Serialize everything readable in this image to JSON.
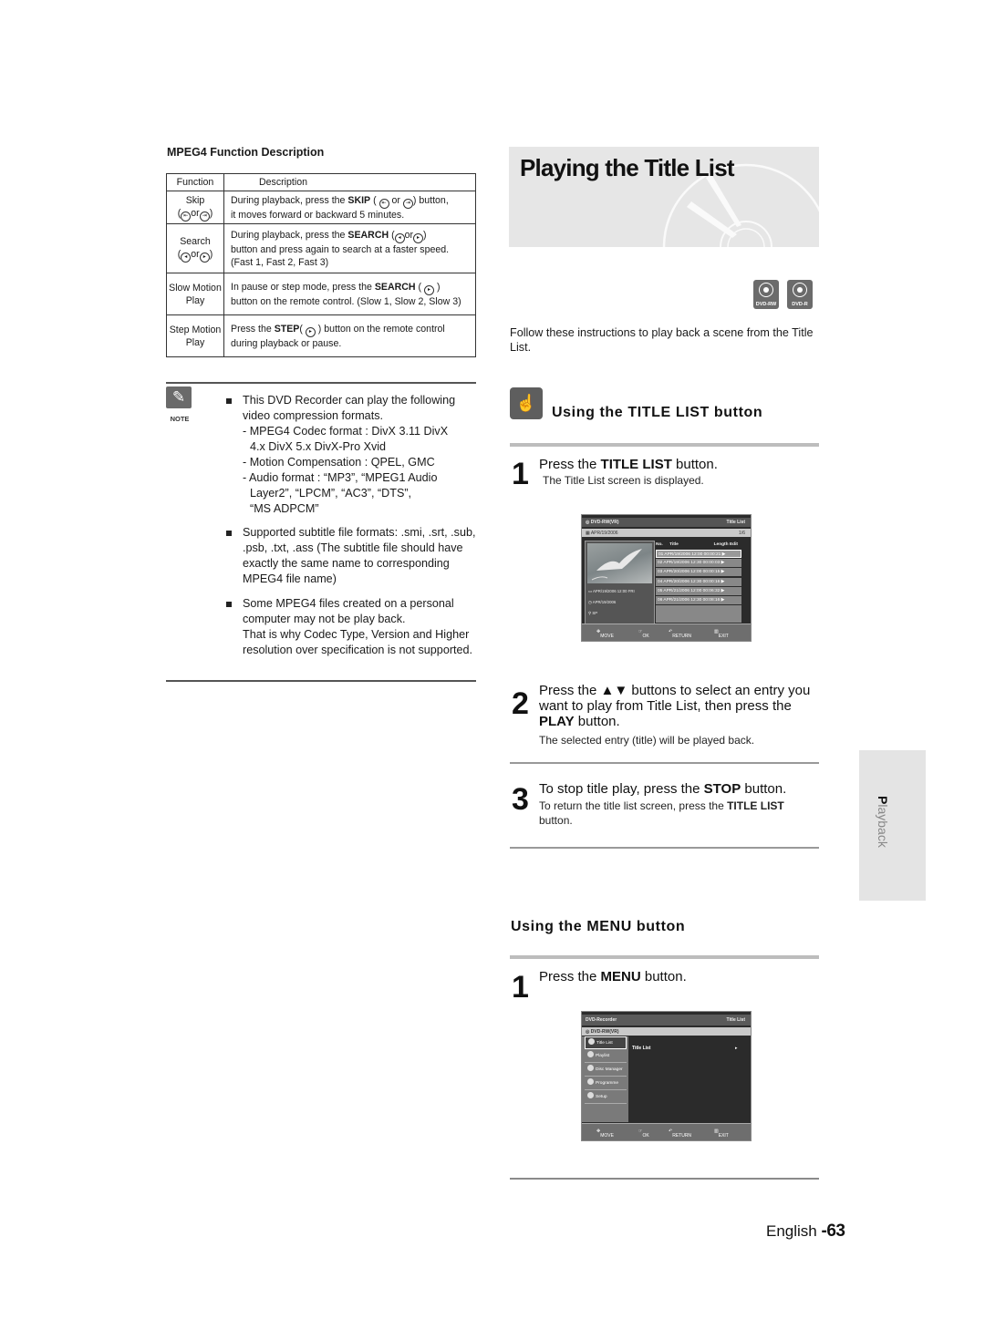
{
  "mpeg4_table": {
    "heading": "MPEG4 Function Description",
    "columns": [
      "Function",
      "Description"
    ],
    "rows": [
      {
        "function": "Skip",
        "function_keys": "or",
        "description_lines": [
          "During playback, press the",
          "SKIP",
          "or",
          "button,",
          "it moves forward or backward 5 minutes."
        ]
      },
      {
        "function": "Search",
        "function_keys": "or",
        "description_lines": [
          "During playback, press the",
          "SEARCH",
          "or",
          "button and press again to search at a faster speed.",
          "(Fast 1, Fast 2, Fast 3)"
        ]
      },
      {
        "function": "Slow Motion",
        "function_line2": "Play",
        "description_lines": [
          "In pause or step mode, press the",
          "SEARCH",
          "button on the remote control. (Slow 1, Slow 2, Slow 3)"
        ]
      },
      {
        "function": "Step Motion",
        "function_line2": "Play",
        "description_lines": [
          "Press the",
          "STEP",
          "button on the remote control",
          "during playback or pause."
        ]
      }
    ]
  },
  "note": {
    "label": "NOTE",
    "icon": "pencil-icon",
    "items": [
      {
        "text": "This DVD Recorder can play the following video compression formats.",
        "subitems": [
          "- MPEG4 Codec format : DivX 3.11 DivX",
          "4.x DivX 5.x DivX-Pro Xvid",
          "- Motion Compensation : QPEL, GMC",
          "- Audio format : “MP3”, “MPEG1 Audio",
          "Layer2”, “LPCM”, “AC3”, “DTS”,",
          "“MS ADPCM”"
        ]
      },
      {
        "text": "Supported subtitle file formats: .smi, .srt, .sub, .psb, .txt, .ass (The subtitle file should have exactly the same name to corresponding MPEG4 file name)"
      },
      {
        "text": "Some MPEG4 files created on a personal computer may not be play back.",
        "text2": "That is why Codec Type, Version and Higher resolution over specification is not supported."
      }
    ]
  },
  "page": {
    "title": "Playing the Title List",
    "disc_badges": [
      "DVD-RW",
      "DVD-R"
    ],
    "intro": "Follow these instructions to play back a scene from the Title List.",
    "side_tab": {
      "first_letter": "P",
      "rest": "layback"
    },
    "footer": {
      "language": "English",
      "page": "-63"
    }
  },
  "title_list_section": {
    "heading": "Using the TITLE LIST button",
    "steps": [
      {
        "number": "1",
        "main_pre": "Press the ",
        "main_bold": "TITLE LIST",
        "main_post": " button.",
        "sub": "The Title List screen is displayed."
      },
      {
        "number": "2",
        "main_pre": "Press the ▲▼ buttons to select an entry you want to play from Title List, then press the ",
        "main_bold": "PLAY",
        "main_post": " button.",
        "sub": "The selected entry (title) will be played back."
      },
      {
        "number": "3",
        "main_pre": "To stop title play, press the ",
        "main_bold": "STOP",
        "main_post": " button.",
        "sub_pre": "To return the title list screen, press the ",
        "sub_bold": "TITLE LIST",
        "sub_post": " button."
      }
    ]
  },
  "title_list_screen": {
    "source": "DVD-RW(VR)",
    "header_right": "Title List",
    "date": "APR/19/2006",
    "counter": "1/6",
    "columns": [
      "No.",
      "Title",
      "Length",
      "Edit"
    ],
    "rows": [
      {
        "no": "01",
        "title": "APR/19/2006 12:00",
        "length": "00:00:21",
        "selected": true
      },
      {
        "no": "02",
        "title": "APR/19/2006 12:30",
        "length": "00:00:03",
        "selected": false
      },
      {
        "no": "03",
        "title": "APR/20/2006 12:00",
        "length": "00:00:15",
        "selected": false
      },
      {
        "no": "04",
        "title": "APR/20/2006 12:30",
        "length": "00:00:16",
        "selected": false
      },
      {
        "no": "05",
        "title": "APR/21/2006 12:00",
        "length": "00:06:32",
        "selected": false
      },
      {
        "no": "06",
        "title": "APR/21/2006 12:30",
        "length": "00:08:16",
        "selected": false
      }
    ],
    "info": [
      "APR/19/2006 12:00 FRI",
      "APR/19/2006",
      "SP"
    ],
    "footer": [
      "MOVE",
      "OK",
      "RETURN",
      "EXIT"
    ]
  },
  "menu_section": {
    "heading": "Using the MENU button",
    "step": {
      "number": "1",
      "main_pre": "Press the ",
      "main_bold": "MENU",
      "main_post": " button."
    }
  },
  "menu_screen": {
    "title": "DVD-Recorder",
    "header_right": "Title List",
    "source": "DVD-RW(VR)",
    "menu_items": [
      "Title List",
      "Playlist",
      "Disc Manager",
      "Programme",
      "Setup"
    ],
    "selected_item": "Title List",
    "content_item": "Title List",
    "footer": [
      "MOVE",
      "OK",
      "RETURN",
      "EXIT"
    ]
  }
}
